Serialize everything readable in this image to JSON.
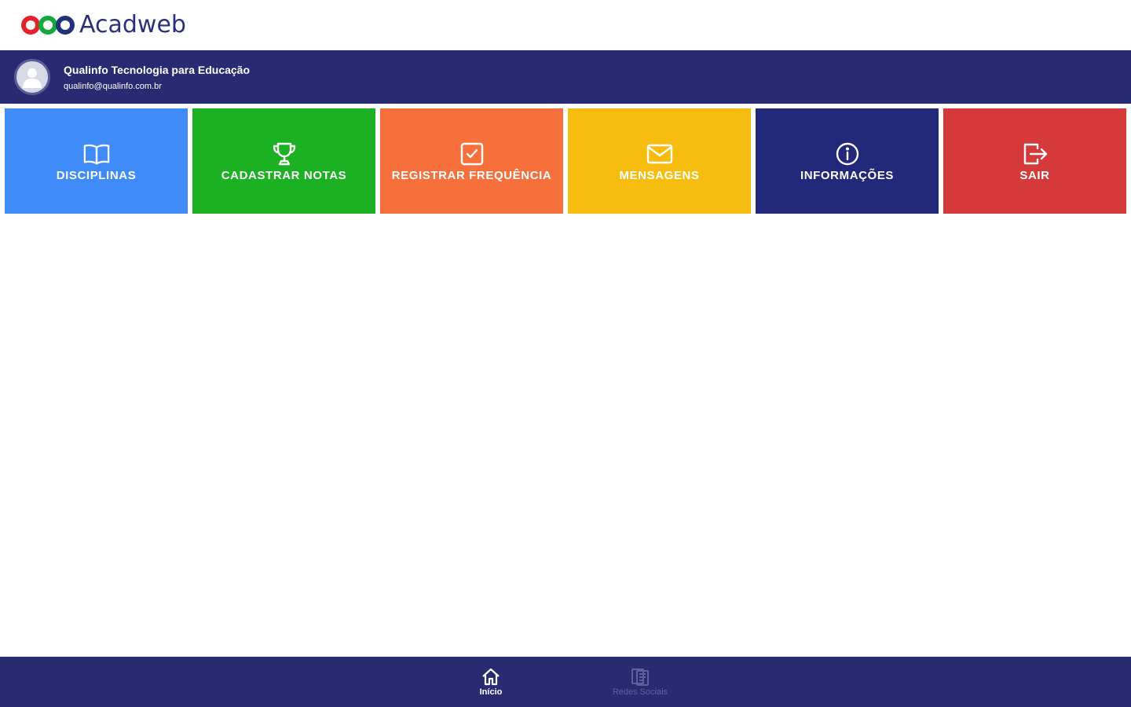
{
  "brand": {
    "name": "Acadweb",
    "colors": {
      "red": "#e3232c",
      "green": "#14a83b",
      "blue": "#24307a"
    }
  },
  "user": {
    "name": "Qualinfo Tecnologia para Educação",
    "email": "qualinfo@qualinfo.com.br",
    "avatar_icon": "user-icon"
  },
  "tiles": [
    {
      "label": "DISCIPLINAS",
      "icon": "book-open-icon",
      "color": "#3f8bfa"
    },
    {
      "label": "CADASTRAR NOTAS",
      "icon": "trophy-icon",
      "color": "#1bb123"
    },
    {
      "label": "REGISTRAR FREQUÊNCIA",
      "icon": "checkbox-icon",
      "color": "#f76f3a"
    },
    {
      "label": "MENSAGENS",
      "icon": "envelope-icon",
      "color": "#f6bd10"
    },
    {
      "label": "INFORMAÇÕES",
      "icon": "info-icon",
      "color": "#22287a"
    },
    {
      "label": "SAIR",
      "icon": "logout-icon",
      "color": "#d6393a"
    }
  ],
  "bottom_nav": [
    {
      "label": "Início",
      "icon": "home-icon",
      "active": true
    },
    {
      "label": "Redes Sociais",
      "icon": "social-icon",
      "active": false
    }
  ],
  "theme": {
    "header_bg": "#282b72"
  }
}
